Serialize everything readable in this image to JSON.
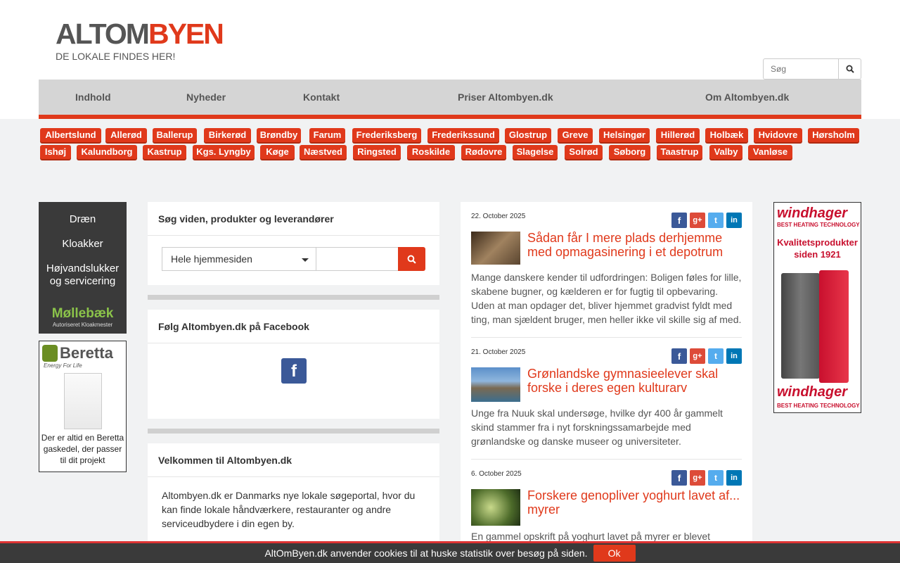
{
  "header": {
    "logo_part1": "ALTOM",
    "logo_part2": "BYEN",
    "tagline": "DE LOKALE FINDES HER!",
    "search_placeholder": "Søg"
  },
  "nav": [
    "Indhold",
    "Nyheder",
    "Kontakt",
    "Priser Altombyen.dk",
    "Om Altombyen.dk"
  ],
  "cities_row1": [
    "Albertslund",
    "Allerød",
    "Ballerup",
    "Birkerød",
    "Brøndby",
    "Farum",
    "Frederiksberg",
    "Frederikssund",
    "Glostrup",
    "Greve",
    "Helsingør",
    "Hillerød",
    "Holbæk",
    "Hvidovre",
    "Hørsholm"
  ],
  "cities_row2": [
    "Ishøj",
    "Kalundborg",
    "Kastrup",
    "Kgs. Lyngby",
    "Køge",
    "Næstved",
    "Ringsted",
    "Roskilde",
    "Rødovre",
    "Slagelse",
    "Solrød",
    "Søborg",
    "Taastrup",
    "Valby",
    "Vanløse"
  ],
  "ad_left1": {
    "lines": [
      "Dræn",
      "Kloakker",
      "Højvandslukker",
      "og servicering"
    ],
    "brand": "Møllebæk",
    "brand_sub": "Autoriseret Kloakmester"
  },
  "ad_left2": {
    "brand": "Beretta",
    "brand_tagline": "Energy For Life",
    "caption": "Der er altid en Beretta gaskedel, der passer til dit projekt"
  },
  "search_panel": {
    "title": "Søg viden, produkter og leverandører",
    "select_value": "Hele hjemmesiden"
  },
  "facebook_panel": {
    "title": "Følg Altombyen.dk på Facebook"
  },
  "welcome_panel": {
    "title": "Velkommen til Altombyen.dk",
    "text": "Altombyen.dk er Danmarks nye lokale søgeportal, hvor du kan finde lokale håndværkere, restauranter og andre serviceudbydere i din egen by."
  },
  "news": [
    {
      "date": "22. October 2025",
      "title": "Sådan får I mere plads derhjemme med opmagasinering i et depotrum",
      "body": "Mange danskere kender til udfordringen: Boligen føles for lille, skabene bugner, og kælderen er for fugtig til opbevaring. Uden at man opdager det, bliver hjemmet gradvist fyldt med ting, man sjældent bruger, men heller ikke vil skille sig af med."
    },
    {
      "date": "21. October 2025",
      "title": "Grønlandske gymnasieelever skal forske i deres egen kulturarv",
      "body": "Unge fra Nuuk skal undersøge, hvilke dyr 400 år gammelt skind stammer fra i nyt forskningssamarbejde med grønlandske og danske museer og universiteter."
    },
    {
      "date": "6. October 2025",
      "title": "Forskere genopliver yoghurt lavet af... myrer",
      "body": "En gammel opskrift på yoghurt lavet på myrer er blevet"
    }
  ],
  "ad_right": {
    "brand": "windhager",
    "tagline": "BEST HEATING TECHNOLOGY",
    "headline": "Kvalitetsprodukter siden 1921"
  },
  "cookie": {
    "text": "AltOmByen.dk anvender cookies til at huske statistik over besøg på siden.",
    "ok": "Ok"
  },
  "colors": {
    "accent": "#e0391b",
    "facebook": "#3b5998",
    "google": "#dd4b39",
    "twitter": "#55acee",
    "linkedin": "#0077b5"
  }
}
